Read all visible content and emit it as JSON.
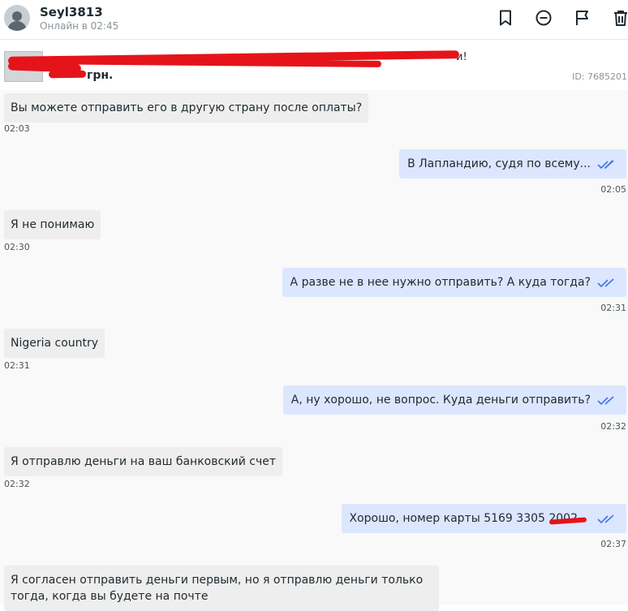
{
  "header": {
    "username": "Seyl3813",
    "status": "Онлайн в 02:45",
    "icons": [
      "bookmark-icon",
      "block-icon",
      "flag-icon",
      "trash-icon"
    ]
  },
  "listing": {
    "title_suffix": "и!",
    "price": "грн.",
    "id": "ID: 7685201"
  },
  "messages": [
    {
      "dir": "in",
      "text": "Вы можете отправить его в другую страну после оплаты?",
      "time": "02:03"
    },
    {
      "dir": "out",
      "text": "В Лапландию, судя по всему...",
      "time": "02:05"
    },
    {
      "dir": "in",
      "text": "Я не понимаю",
      "time": "02:30"
    },
    {
      "dir": "out",
      "text": "А разве не в нее нужно отправить? А куда тогда?",
      "time": "02:31"
    },
    {
      "dir": "in",
      "text": "Nigeria country",
      "time": "02:31"
    },
    {
      "dir": "out",
      "text": "А, ну хорошо, не вопрос. Куда деньги отправить?",
      "time": "02:32"
    },
    {
      "dir": "in",
      "text": "Я отправлю деньги на ваш банковский счет",
      "time": "02:32"
    },
    {
      "dir": "out",
      "text": "Хорошо, номер карты 5169 3305 2002",
      "time": "02:37"
    },
    {
      "dir": "in",
      "text": "Я согласен отправить деньги первым, но я отправлю деньги только тогда, когда вы будете на почте",
      "time": ""
    }
  ],
  "colors": {
    "incoming_bubble": "#eeeeee",
    "outgoing_bubble": "#dce6ff",
    "read_ticks": "#3a77e6",
    "redaction": "#e5141a"
  }
}
